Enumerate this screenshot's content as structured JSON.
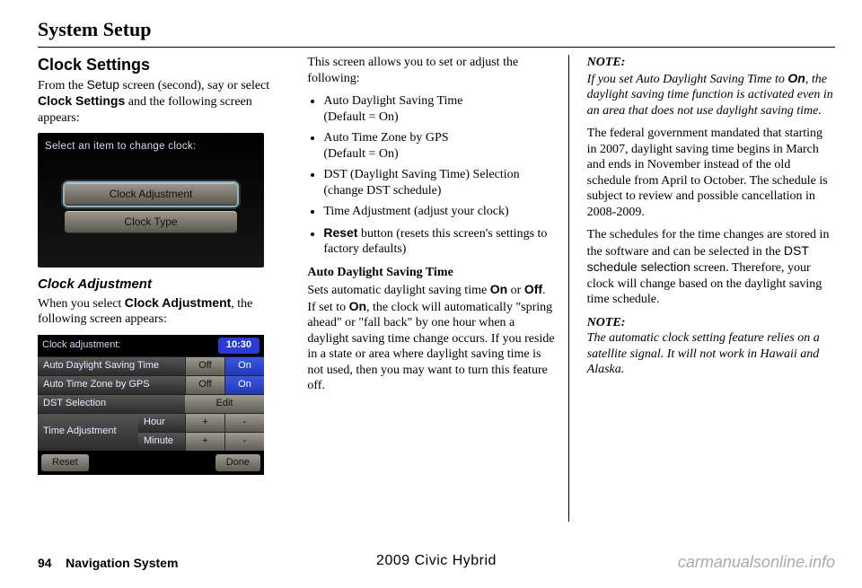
{
  "header": {
    "title": "System Setup"
  },
  "left": {
    "section_title": "Clock Settings",
    "intro_1a": "From the ",
    "intro_setup": "Setup",
    "intro_1b": " screen (second), say or select ",
    "intro_cs": "Clock Settings",
    "intro_1c": " and the following screen appears:",
    "shot1": {
      "prompt": "Select an item to change clock:",
      "btn1": "Clock Adjustment",
      "btn2": "Clock Type"
    },
    "sub_title": "Clock Adjustment",
    "sub_1a": "When you select ",
    "sub_ca": "Clock Adjustment",
    "sub_1b": ", the following screen appears:",
    "shot2": {
      "title": "Clock adjustment:",
      "time": "10:30",
      "r1": "Auto Daylight Saving Time",
      "off": "Off",
      "on": "On",
      "r2": "Auto Time Zone by GPS",
      "r3": "DST Selection",
      "edit": "Edit",
      "r4": "Time Adjustment",
      "hour": "Hour",
      "minute": "Minute",
      "plus": "+",
      "minus": "-",
      "reset": "Reset",
      "done": "Done"
    }
  },
  "mid": {
    "p1": "This screen allows you to set or adjust the following:",
    "b1a": "Auto Daylight Saving Time",
    "b1b": "(Default = On)",
    "b2a": "Auto Time Zone by GPS",
    "b2b": "(Default = On)",
    "b3a": "DST (Daylight Saving Time) Selection",
    "b3b": "(change DST schedule)",
    "b4": "Time Adjustment (adjust your clock)",
    "b5_reset": "Reset",
    "b5_rest": " button (resets this screen's settings to factory defaults)",
    "h2": "Auto Daylight Saving Time",
    "p2a": "Sets automatic daylight saving time ",
    "on": "On",
    "p2b": " or ",
    "off": "Off",
    "p2c": ". If set to ",
    "p2d": ", the clock will automatically \"spring ahead\" or \"fall back\" by one hour when a daylight saving time change occurs. If you reside in a state or area where daylight saving time is not used, then you may want to turn this feature off."
  },
  "right": {
    "note_label": "NOTE:",
    "n1a": "If you set Auto Daylight Saving Time to ",
    "n1_on": "On",
    "n1b": ", the daylight saving time function is activated even in an area that does not use daylight saving time.",
    "p2": "The federal government mandated that starting in 2007, daylight saving time begins in March and ends in November instead of the old schedule from April to October. The schedule is subject to review and possible cancellation in 2008-2009.",
    "p3a": "The schedules for the time changes are stored in the software and can be selected in the ",
    "p3_dst": "DST schedule selection",
    "p3b": " screen. Therefore, your clock will change based on the daylight saving time schedule.",
    "n2": "The automatic clock setting feature relies on a satellite signal. It will not work in Hawaii and Alaska."
  },
  "footer": {
    "page_num": "94",
    "page_label": "Navigation System",
    "model": "2009  Civic  Hybrid",
    "watermark": "carmanualsonline.info"
  }
}
